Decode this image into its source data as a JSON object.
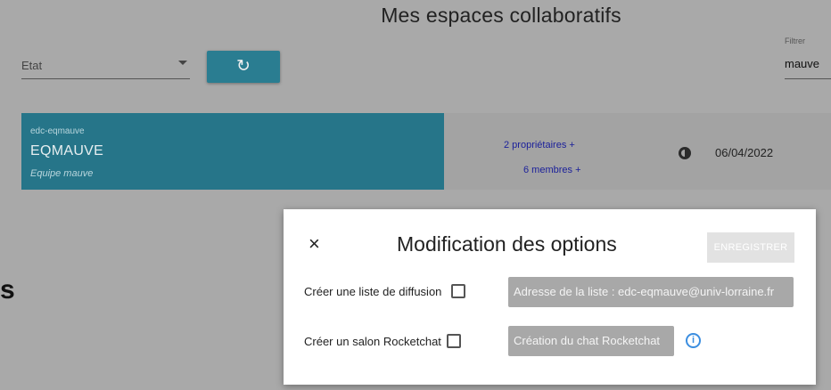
{
  "header": {
    "title": "Mes espaces collaboratifs",
    "etat_label": "Etat",
    "refresh_icon": "↻",
    "filter_label": "Filtrer",
    "filter_value": "mauve"
  },
  "space": {
    "code": "edc-eqmauve",
    "name": "EQMAUVE",
    "description": "Equipe mauve",
    "owners": "2 propriétaires +",
    "members": "6 membres +",
    "date_icon": "clock-icon",
    "date": "06/04/2022"
  },
  "background_fragment": "s",
  "modal": {
    "close_icon": "×",
    "title": "Modification des options",
    "save_label": "ENREGISTRER",
    "diffusion_label": "Créer une liste de diffusion",
    "diffusion_address": "Adresse de la liste : edc-eqmauve@univ-lorraine.fr",
    "rocketchat_label": "Créer un salon Rocketchat",
    "rocketchat_button": "Création du chat Rocketchat",
    "info_icon": "i"
  },
  "colors": {
    "overlay": "#a9a9a9",
    "accent": "#2a7d91",
    "link": "#1a1f9a",
    "info": "#3b8ee0"
  }
}
